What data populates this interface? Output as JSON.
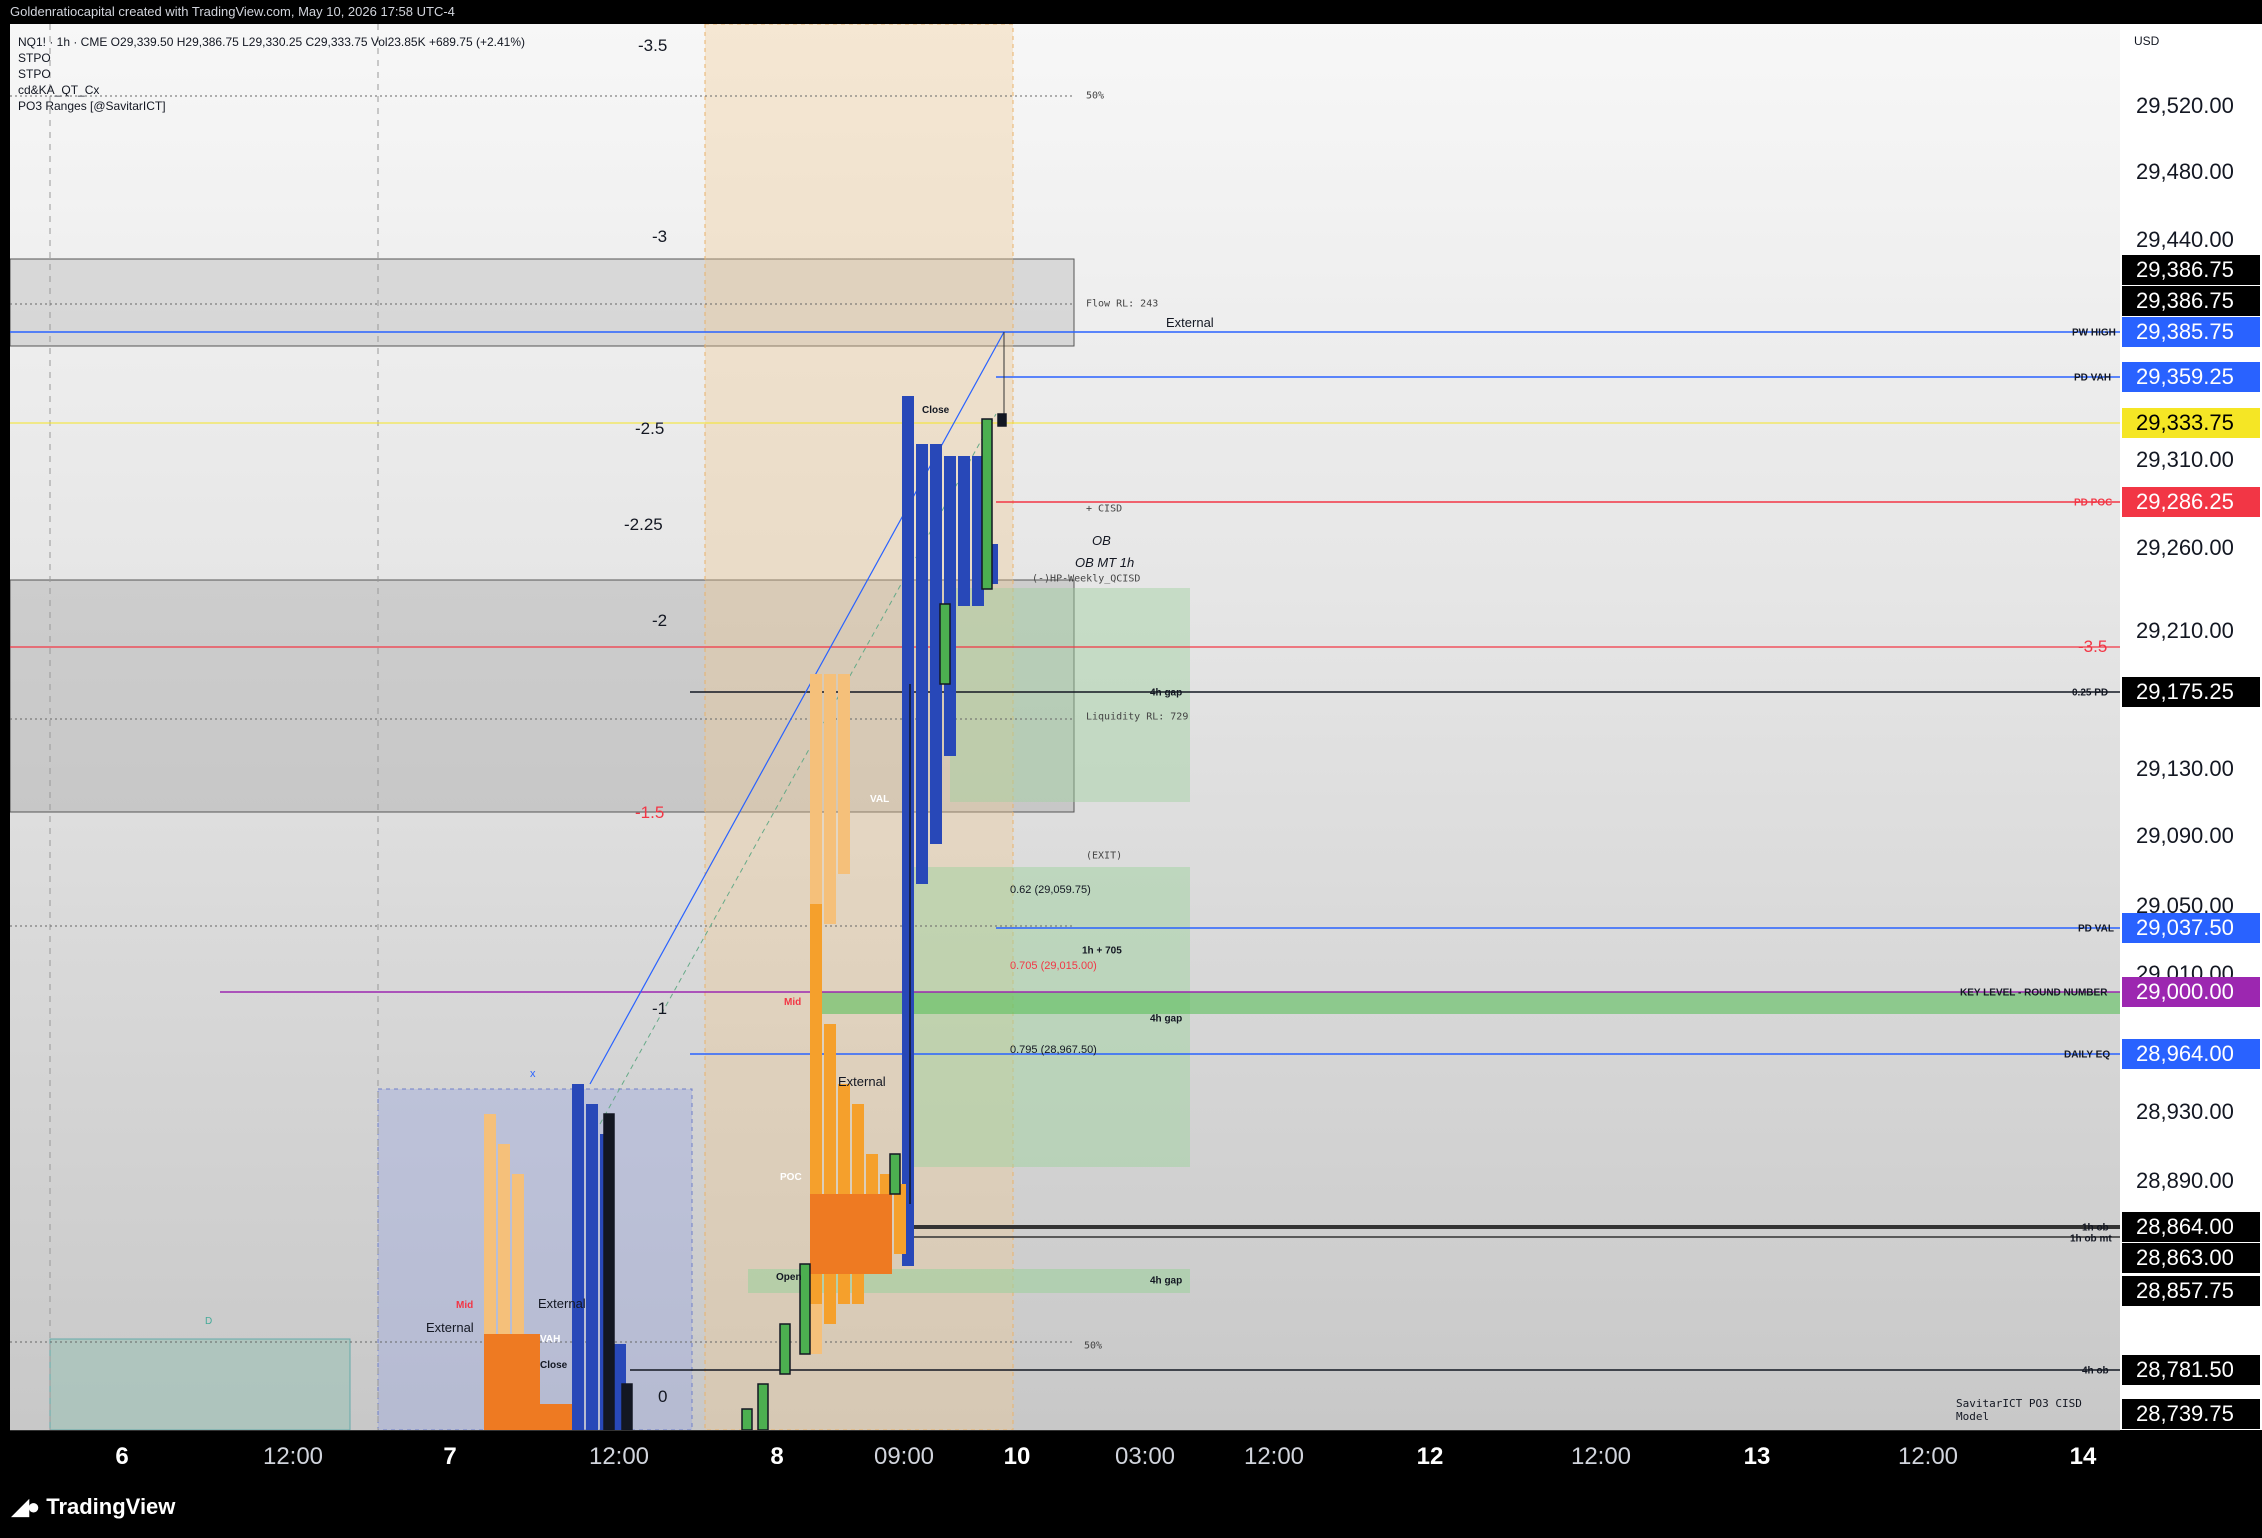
{
  "header": {
    "title": "Goldenratiocapital created with TradingView.com, May 10, 2026 17:58 UTC-4"
  },
  "legend": {
    "line1": "NQ1! · 1h · CME  O29,339.50  H29,386.75  L29,330.25  C29,333.75  Vol23.85K  +689.75 (+2.41%)",
    "indicators": [
      "STPO",
      "STPO",
      "cd&KA_QT_Cx",
      "PO3 Ranges [@SavitarICT]"
    ]
  },
  "price_axis": {
    "currency": "USD",
    "ticks": [
      "29,520.00",
      "29,480.00",
      "29,440.00",
      "29,310.00",
      "29,260.00",
      "29,210.00",
      "29,130.00",
      "29,090.00",
      "29,050.00",
      "29,010.00",
      "28,930.00",
      "28,890.00"
    ],
    "tags": [
      {
        "value": "29,386.75",
        "color": "#000000"
      },
      {
        "value": "29,386.75",
        "color": "#000000"
      },
      {
        "value": "29,385.75",
        "color": "#2962ff"
      },
      {
        "value": "29,359.25",
        "color": "#2962ff"
      },
      {
        "value": "29,333.75",
        "color": "#f5e625",
        "text_color": "#000000"
      },
      {
        "value": "29,286.25",
        "color": "#f23645"
      },
      {
        "value": "29,175.25",
        "color": "#000000"
      },
      {
        "value": "29,037.50",
        "color": "#2962ff"
      },
      {
        "value": "29,000.00",
        "color": "#9c27b0"
      },
      {
        "value": "28,964.00",
        "color": "#2962ff"
      },
      {
        "value": "28,864.00",
        "color": "#000000"
      },
      {
        "value": "28,863.00",
        "color": "#000000"
      },
      {
        "value": "28,857.75",
        "color": "#000000"
      },
      {
        "value": "28,781.50",
        "color": "#000000"
      },
      {
        "value": "28,739.75",
        "color": "#000000"
      }
    ]
  },
  "time_axis": {
    "labels": [
      {
        "text": "6",
        "bold": true
      },
      {
        "text": "12:00",
        "bold": false
      },
      {
        "text": "7",
        "bold": true
      },
      {
        "text": "12:00",
        "bold": false
      },
      {
        "text": "8",
        "bold": true
      },
      {
        "text": "09:00",
        "bold": false
      },
      {
        "text": "10",
        "bold": true
      },
      {
        "text": "03:00",
        "bold": false
      },
      {
        "text": "12:00",
        "bold": false
      },
      {
        "text": "12",
        "bold": true
      },
      {
        "text": "12:00",
        "bold": false
      },
      {
        "text": "13",
        "bold": true
      },
      {
        "text": "12:00",
        "bold": false
      },
      {
        "text": "14",
        "bold": true
      }
    ]
  },
  "fib_levels": [
    "-3.5",
    "-3",
    "-2.5",
    "-2.25",
    "-2",
    "-1.5",
    "-1",
    "0"
  ],
  "fib_red_label": "-3.5",
  "line_labels": {
    "pw_high": "PW HIGH",
    "pd_vah": "PD VAH",
    "pd_poc": "PD POC",
    "quarter_pd": "0.25 PD",
    "pd_val": "PD VAL",
    "key_level": "KEY LEVEL - ROUND NUMBER",
    "daily_eq": "DAILY EQ",
    "ob_1h": "1h ob",
    "ob_1h_mt": "1h ob mt",
    "ob_4h": "4h ob",
    "gap_4h": "4h gap",
    "gap_1h": "1h + 705"
  },
  "annotations": {
    "flow_rl": "Flow RL: 243",
    "external": "External",
    "cisd": "+ CISD",
    "ob": "OB",
    "ob_mt": "OB MT 1h",
    "weekly_qcisd": "(-)HP-Weekly_QCISD",
    "liquidity_rl": "Liquidity RL: 729",
    "exit": "(EXIT)",
    "fib_062": "0.62 (29,059.75)",
    "fib_0705": "0.705 (29,015.00)",
    "fib_0795": "0.795 (28,967.50)",
    "fifty": "50%",
    "close": "Close",
    "mid": "Mid",
    "poc": "POC",
    "val": "VAL",
    "vah": "VAH",
    "open": "Open",
    "model": "SavitarICT PO3 CISD Model",
    "d_marker": "D",
    "x_marker": "x"
  },
  "footer": {
    "brand": "TradingView"
  }
}
